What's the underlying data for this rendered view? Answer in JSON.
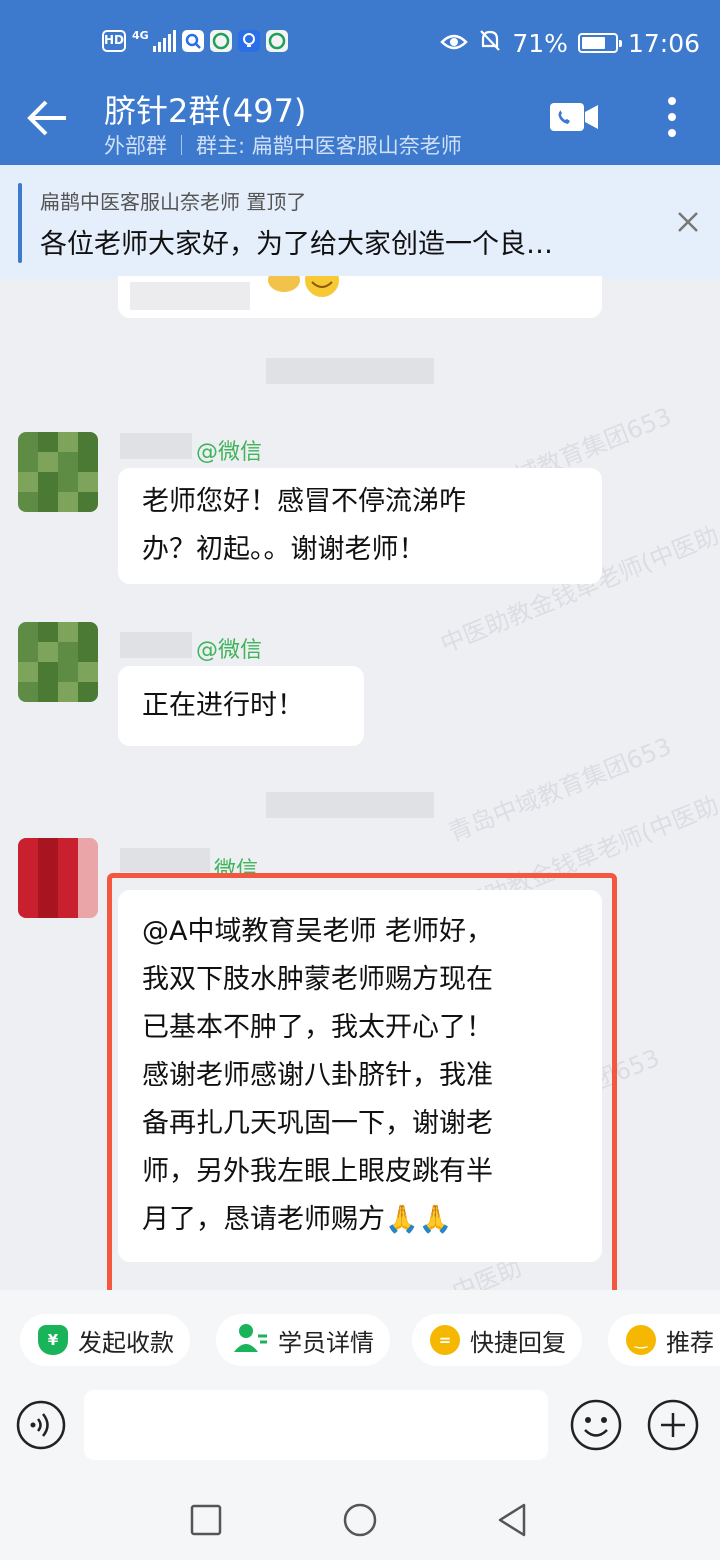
{
  "status_bar": {
    "hd": "HD",
    "network": "4G",
    "battery_percent": "71%",
    "battery_level": 0.71,
    "time": "17:06"
  },
  "header": {
    "title": "脐针2群(497)",
    "group_type": "外部群",
    "owner": "群主: 扁鹊中医客服山奈老师"
  },
  "pinned": {
    "source": "扁鹊中医客服山奈老师 置顶了",
    "text": "各位老师大家好，为了给大家创造一个良…"
  },
  "messages": [
    {
      "sender_suffix": "@微信",
      "text_lines": [
        "老师您好！感冒不停流涕咋",
        "办？初起。。谢谢老师！"
      ]
    },
    {
      "sender_suffix": "@微信",
      "text_lines": [
        "正在进行时！"
      ]
    },
    {
      "sender_suffix": "微信",
      "text_lines": [
        "@A中域教育吴老师 老师好，",
        "我双下肢水肿蒙老师赐方现在",
        "已基本不肿了，我太开心了！",
        "感谢老师感谢八卦脐针，我准",
        "备再扎几天巩固一下，谢谢老",
        "师，另外我左眼上眼皮跳有半",
        "月了，恳请老师赐方🙏🙏"
      ]
    }
  ],
  "watermarks": [
    "中医助教金钱草老师(中医助",
    "青岛中域教育集团653",
    "中医助教金钱草老师(中医助",
    "青岛中域教育集团653",
    "团653",
    "中医助"
  ],
  "quick_actions": [
    {
      "label": "发起收款",
      "icon": "¥",
      "color": "#19b35a"
    },
    {
      "label": "学员详情",
      "icon": "person",
      "color": "#19b35a"
    },
    {
      "label": "快捷回复",
      "icon": "=",
      "color": "#f5b700"
    },
    {
      "label": "推荐",
      "icon": "‿",
      "color": "#f5b700"
    }
  ]
}
